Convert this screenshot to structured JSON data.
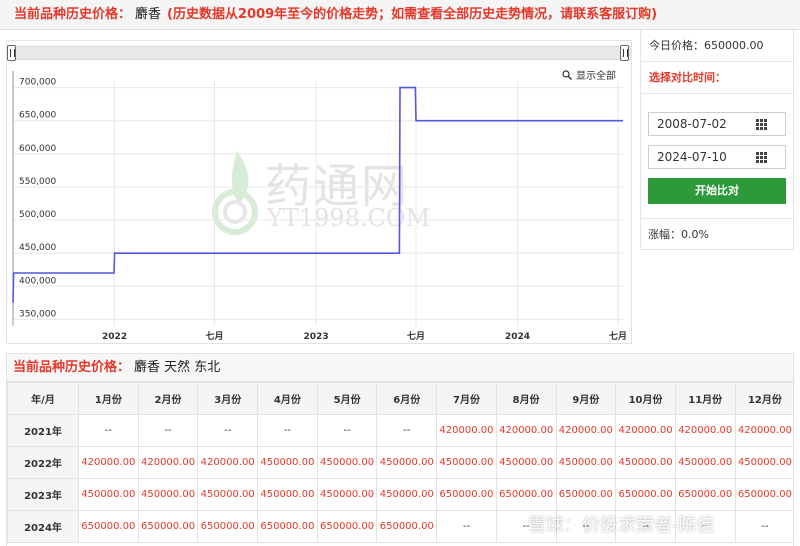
{
  "header": {
    "label": "当前品种历史价格：",
    "product": "麝香",
    "note": "(历史数据从2009年至今的价格走势；如需查看全部历史走势情况，请联系客服订购)"
  },
  "chart": {
    "show_all_label": "显示全部",
    "watermark_cn": "药通网",
    "watermark_en": "YT1998.COM",
    "line_color": "#5555dd"
  },
  "chart_data": {
    "type": "line",
    "title": "",
    "xlabel": "",
    "ylabel": "",
    "ylim": [
      340000,
      710000
    ],
    "yticks": [
      350000,
      400000,
      450000,
      500000,
      550000,
      600000,
      650000,
      700000
    ],
    "ytick_labels": [
      "350,000",
      "400,000",
      "450,000",
      "500,000",
      "550,000",
      "600,000",
      "650,000",
      "700,000"
    ],
    "xticks": [
      "2022-01-01",
      "2022-07-01",
      "2023-01-01",
      "2023-07-01",
      "2024-01-01",
      "2024-07-01"
    ],
    "xtick_labels": [
      "2022",
      "七月",
      "2023",
      "七月",
      "2024",
      "七月"
    ],
    "xlim": [
      "2021-07-01",
      "2024-07-10"
    ],
    "grid": true,
    "series": [
      {
        "x": [
          "2021-07-01",
          "2021-07-02",
          "2021-12-31",
          "2022-01-01",
          "2023-06-01",
          "2023-06-02",
          "2023-06-30",
          "2023-07-01",
          "2024-07-10"
        ],
        "y": [
          375000,
          420000,
          420000,
          450000,
          450000,
          700000,
          700000,
          650000,
          650000
        ]
      }
    ]
  },
  "side": {
    "today_label": "今日价格：",
    "today_value": "650000.00",
    "compare_label": "选择对比时间：",
    "start_date": "2008-07-02",
    "end_date": "2024-07-10",
    "button_label": "开始比对",
    "change_label": "涨幅：",
    "change_value": "0.0%"
  },
  "table": {
    "title_label": "当前品种历史价格：",
    "title_name": "麝香 天然 东北",
    "headers": [
      "年/月",
      "1月份",
      "2月份",
      "3月份",
      "4月份",
      "5月份",
      "6月份",
      "7月份",
      "8月份",
      "9月份",
      "10月份",
      "11月份",
      "12月份"
    ],
    "rows": [
      {
        "year": "2021年",
        "values": [
          "--",
          "--",
          "--",
          "--",
          "--",
          "--",
          "420000.00",
          "420000.00",
          "420000.00",
          "420000.00",
          "420000.00",
          "420000.00"
        ]
      },
      {
        "year": "2022年",
        "values": [
          "420000.00",
          "420000.00",
          "420000.00",
          "450000.00",
          "450000.00",
          "450000.00",
          "450000.00",
          "450000.00",
          "450000.00",
          "450000.00",
          "450000.00",
          "450000.00"
        ]
      },
      {
        "year": "2023年",
        "values": [
          "450000.00",
          "450000.00",
          "450000.00",
          "450000.00",
          "450000.00",
          "450000.00",
          "650000.00",
          "650000.00",
          "650000.00",
          "650000.00",
          "650000.00",
          "650000.00"
        ]
      },
      {
        "year": "2024年",
        "values": [
          "650000.00",
          "650000.00",
          "650000.00",
          "650000.00",
          "650000.00",
          "650000.00",
          "--",
          "--",
          "--",
          "--",
          "--",
          "--"
        ]
      }
    ]
  },
  "footer": {
    "text": "雪球：价投求索者-陈佳"
  }
}
